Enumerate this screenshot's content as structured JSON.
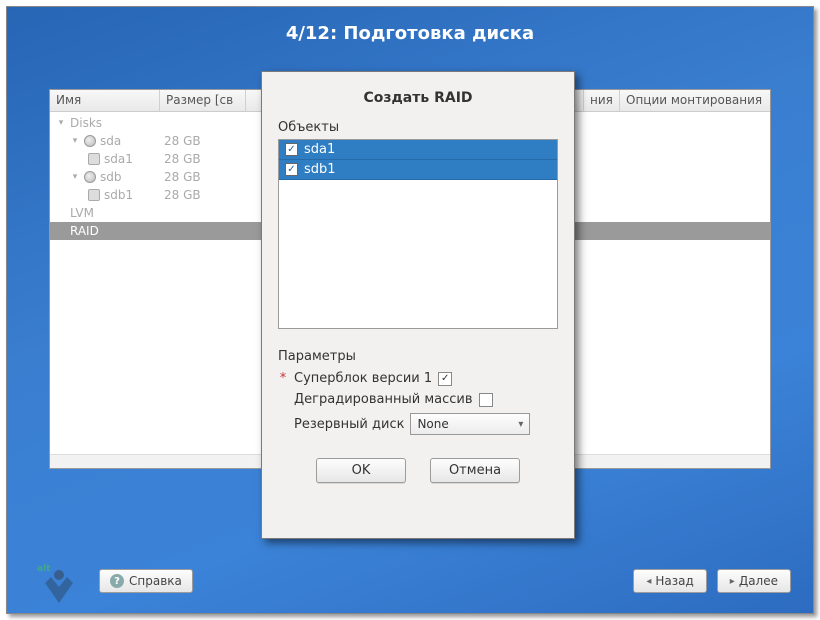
{
  "title": "4/12: Подготовка диска",
  "columns": {
    "name": "Имя",
    "size": "Размер [св",
    "partial": "ния",
    "mount": "Опции монтирования"
  },
  "tree": {
    "disks_label": "Disks",
    "items": [
      {
        "name": "sda",
        "size": "28 GB",
        "kind": "disk"
      },
      {
        "name": "sda1",
        "size": "28 GB",
        "kind": "part"
      },
      {
        "name": "sdb",
        "size": "28 GB",
        "kind": "disk"
      },
      {
        "name": "sdb1",
        "size": "28 GB",
        "kind": "part"
      }
    ],
    "lvm": "LVM",
    "raid": "RAID"
  },
  "dialog": {
    "title": "Создать RAID",
    "objects_label": "Объекты",
    "objects": [
      "sda1",
      "sdb1"
    ],
    "params_label": "Параметры",
    "superblock": "Суперблок версии 1",
    "degraded": "Деградированный массив",
    "spare": "Резервный диск",
    "spare_value": "None",
    "ok": "OK",
    "cancel": "Отмена"
  },
  "footer": {
    "help": "Справка",
    "back": "Назад",
    "next": "Далее"
  }
}
